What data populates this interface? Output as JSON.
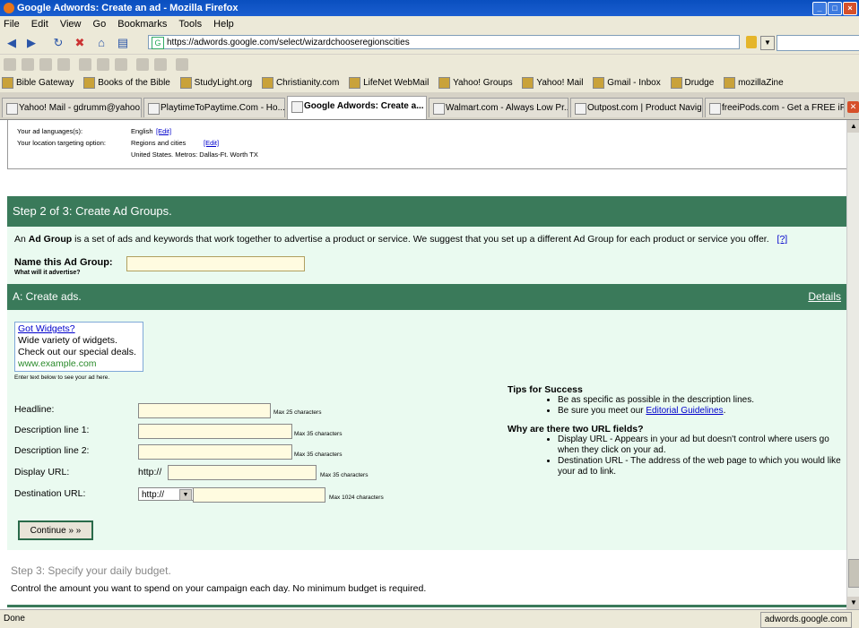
{
  "window": {
    "title": "Google Adwords: Create an ad - Mozilla Firefox",
    "controls": [
      "_",
      "□",
      "×"
    ]
  },
  "menu": [
    "File",
    "Edit",
    "View",
    "Go",
    "Bookmarks",
    "Tools",
    "Help"
  ],
  "url": "https://adwords.google.com/select/wizardchooseregionscities",
  "bookmarks": [
    "Bible Gateway",
    "Books of the Bible",
    "StudyLight.org",
    "Christianity.com",
    "LifeNet WebMail",
    "Yahoo! Groups",
    "Yahoo! Mail",
    "Gmail - Inbox",
    "Drudge",
    "mozillaZine"
  ],
  "tabs": [
    {
      "label": "Yahoo! Mail - gdrumm@yahoo...",
      "active": false
    },
    {
      "label": "PlaytimeToPaytime.Com - Ho...",
      "active": false
    },
    {
      "label": "Google Adwords: Create a...",
      "active": true
    },
    {
      "label": "Walmart.com - Always Low Pr...",
      "active": false
    },
    {
      "label": "Outpost.com | Product Navig...",
      "active": false
    },
    {
      "label": "freeiPods.com - Get a FREE iP...",
      "active": false
    }
  ],
  "summary": {
    "lang_label": "Your ad languages(s):",
    "lang_value": "English",
    "lang_edit": "[Edit]",
    "loc_label": "Your location targeting option:",
    "loc_value": "Regions and cities",
    "loc_edit": "[Edit]",
    "loc_detail": "United States. Metros: Dallas-Ft. Worth TX"
  },
  "step2": {
    "title": "Step 2 of 3: Create Ad Groups.",
    "intro_pre": "An ",
    "intro_bold": "Ad Group",
    "intro_post": " is a set of ads and keywords that work together to advertise a product or service. We suggest that you set up a different Ad Group for each product or service you offer.",
    "help": "[?]",
    "name_label": "Name this Ad Group:",
    "name_sub": "What will it advertise?",
    "name_value": ""
  },
  "create_ads": {
    "title": "A: Create ads.",
    "details": "Details",
    "preview": {
      "title": "Got Widgets?",
      "line1": "Wide variety of widgets.",
      "line2": "Check out our special deals.",
      "url": "www.example.com"
    },
    "enter_text": "Enter text below to see your ad here.",
    "fields": {
      "headline": {
        "label": "Headline:",
        "max": "Max 25 characters",
        "value": ""
      },
      "desc1": {
        "label": "Description line 1:",
        "max": "Max 35 characters",
        "value": ""
      },
      "desc2": {
        "label": "Description line 2:",
        "max": "Max 35 characters",
        "value": ""
      },
      "display": {
        "label": "Display URL:",
        "prefix": "http://",
        "max": "Max 35 characters",
        "value": ""
      },
      "dest": {
        "label": "Destination URL:",
        "select": "http://",
        "max": "Max 1024 characters",
        "value": ""
      }
    },
    "continue": "Continue » »"
  },
  "tips": {
    "title": "Tips for Success",
    "items": [
      "Be as specific as possible in the description lines.",
      "Be sure you meet our "
    ],
    "link": "Editorial Guidelines",
    "link_after": ".",
    "why_title": "Why are there two URL fields?",
    "why_items": [
      "Display URL - Appears in your ad but doesn't control where users go when they click on your ad.",
      "Destination URL - The address of the web page to which you would like your ad to link."
    ]
  },
  "step3": {
    "title": "Step 3: Specify your daily budget.",
    "text": "Control the amount you want to spend on your campaign each day. No minimum budget is required."
  },
  "status": {
    "left": "Done",
    "right": "adwords.google.com"
  }
}
